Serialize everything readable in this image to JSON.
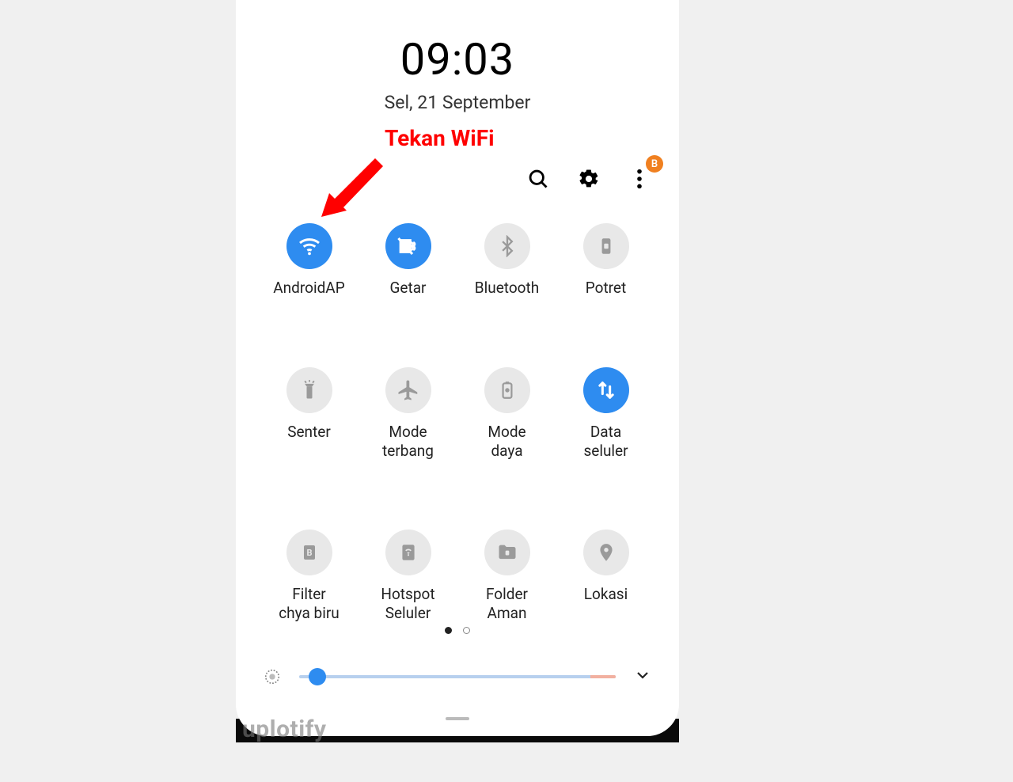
{
  "header": {
    "time": "09:03",
    "date": "Sel, 21 September"
  },
  "annotation": {
    "text": "Tekan WiFi"
  },
  "toolbar": {
    "badge": "B"
  },
  "tiles": [
    {
      "id": "wifi",
      "label": "AndroidAP",
      "icon": "wifi",
      "active": true
    },
    {
      "id": "vibrate",
      "label": "Getar",
      "icon": "vibrate",
      "active": true
    },
    {
      "id": "bluetooth",
      "label": "Bluetooth",
      "icon": "bluetooth",
      "active": false
    },
    {
      "id": "portrait",
      "label": "Potret",
      "icon": "portrait",
      "active": false
    },
    {
      "id": "flashlight",
      "label": "Senter",
      "icon": "flashlight",
      "active": false
    },
    {
      "id": "airplane",
      "label": "Mode\nterbang",
      "icon": "airplane",
      "active": false
    },
    {
      "id": "power",
      "label": "Mode\ndaya",
      "icon": "battery",
      "active": false
    },
    {
      "id": "mobiledata",
      "label": "Data\nseluler",
      "icon": "data",
      "active": true
    },
    {
      "id": "bluelight",
      "label": "Filter\nchya biru",
      "icon": "bluelight",
      "active": false
    },
    {
      "id": "hotspot",
      "label": "Hotspot\nSeluler",
      "icon": "hotspot",
      "active": false
    },
    {
      "id": "securefolder",
      "label": "Folder\nAman",
      "icon": "folder",
      "active": false
    },
    {
      "id": "location",
      "label": "Lokasi",
      "icon": "location",
      "active": false
    }
  ],
  "pager": {
    "current": 0,
    "total": 2
  },
  "brightness": {
    "value": 5,
    "max": 100
  },
  "watermark": "uplotify",
  "colors": {
    "accent": "#2e8cf0",
    "inactive": "#e8e8e8",
    "annotation": "#ff0000",
    "badge": "#f08020"
  }
}
